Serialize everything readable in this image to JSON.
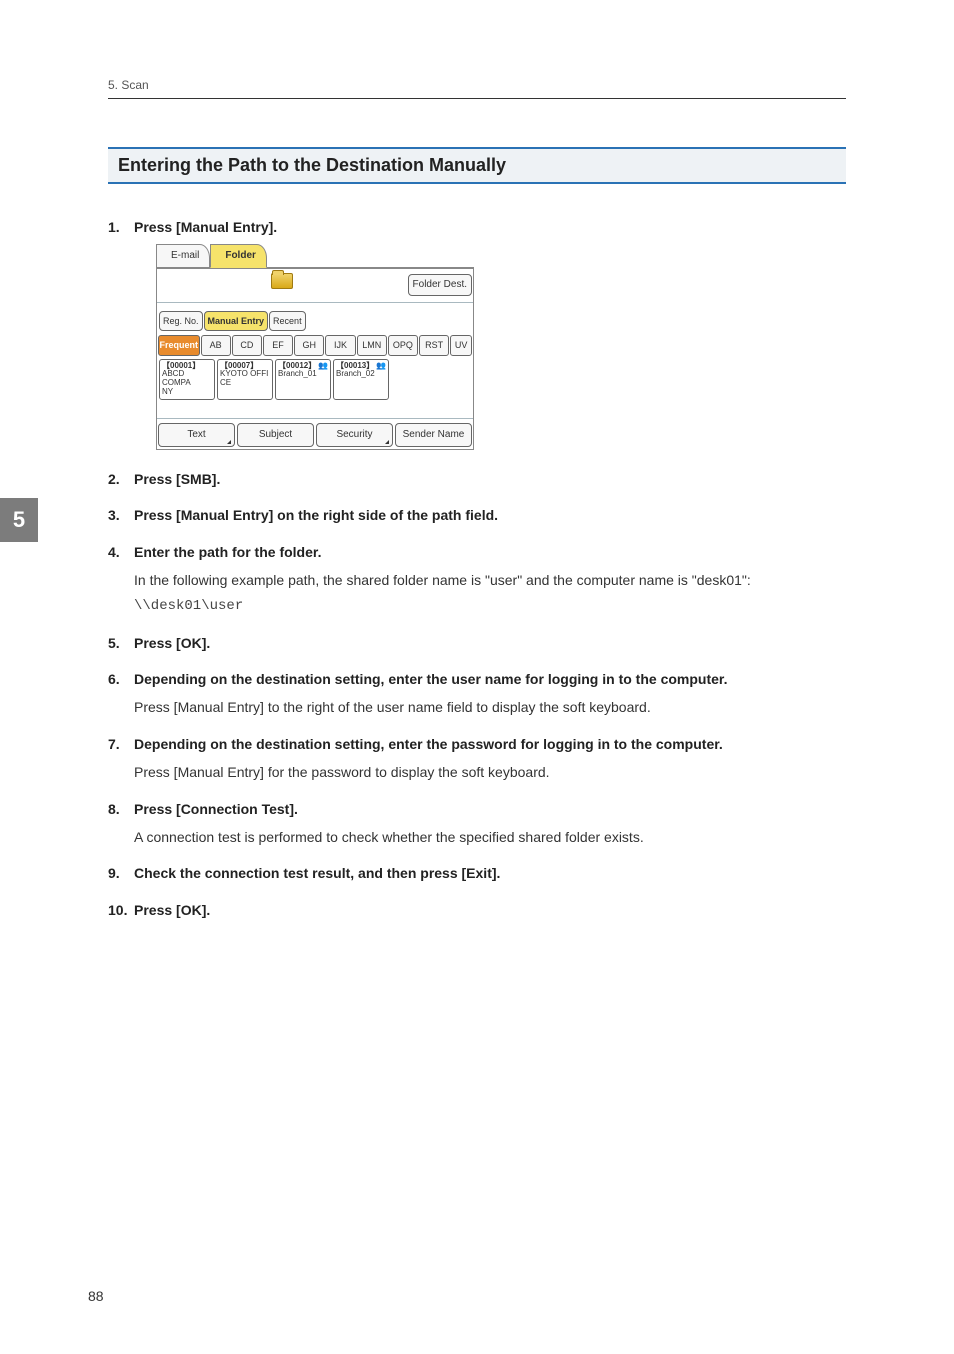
{
  "header": {
    "breadcrumb": "5. Scan"
  },
  "chapter_tab": "5",
  "page_number": "88",
  "section": {
    "title": "Entering the Path to the Destination Manually"
  },
  "steps": [
    {
      "n": "1.",
      "title": "Press [Manual Entry]."
    },
    {
      "n": "2.",
      "title": "Press [SMB]."
    },
    {
      "n": "3.",
      "title": "Press [Manual Entry] on the right side of the path field."
    },
    {
      "n": "4.",
      "title": "Enter the path for the folder.",
      "body": "In the following example path, the shared folder name is \"user\" and the computer name is \"desk01\":",
      "code": "\\\\desk01\\user"
    },
    {
      "n": "5.",
      "title": "Press [OK]."
    },
    {
      "n": "6.",
      "title": "Depending on the destination setting, enter the user name for logging in to the computer.",
      "body": "Press [Manual Entry] to the right of the user name field to display the soft keyboard."
    },
    {
      "n": "7.",
      "title": "Depending on the destination setting, enter the password for logging in to the computer.",
      "body": "Press [Manual Entry] for the password to display the soft keyboard."
    },
    {
      "n": "8.",
      "title": "Press [Connection Test].",
      "body": "A connection test is performed to check whether the specified shared folder exists."
    },
    {
      "n": "9.",
      "title": "Check the connection test result, and then press [Exit]."
    },
    {
      "n": "10.",
      "title": "Press [OK]."
    }
  ],
  "ui": {
    "tabs": {
      "email": "E-mail",
      "folder": "Folder"
    },
    "folder_dest": "Folder Dest.",
    "row_btns": {
      "reg_no": "Reg. No.",
      "manual_entry": "Manual Entry",
      "recent": "Recent"
    },
    "index": {
      "freq": "Frequent",
      "groups": [
        "AB",
        "CD",
        "EF",
        "GH",
        "IJK",
        "LMN",
        "OPQ",
        "RST",
        "UV"
      ]
    },
    "dests": [
      {
        "id": "【00001】",
        "name1": "ABCD COMPA",
        "name2": "NY",
        "share": false
      },
      {
        "id": "【00007】",
        "name1": "KYOTO OFFI",
        "name2": "CE",
        "share": false
      },
      {
        "id": "【00012】",
        "name1": "Branch_01",
        "name2": "",
        "share": true
      },
      {
        "id": "【00013】",
        "name1": "Branch_02",
        "name2": "",
        "share": true
      }
    ],
    "bottom": {
      "text": "Text",
      "subject": "Subject",
      "security": "Security",
      "sender": "Sender Name"
    }
  }
}
